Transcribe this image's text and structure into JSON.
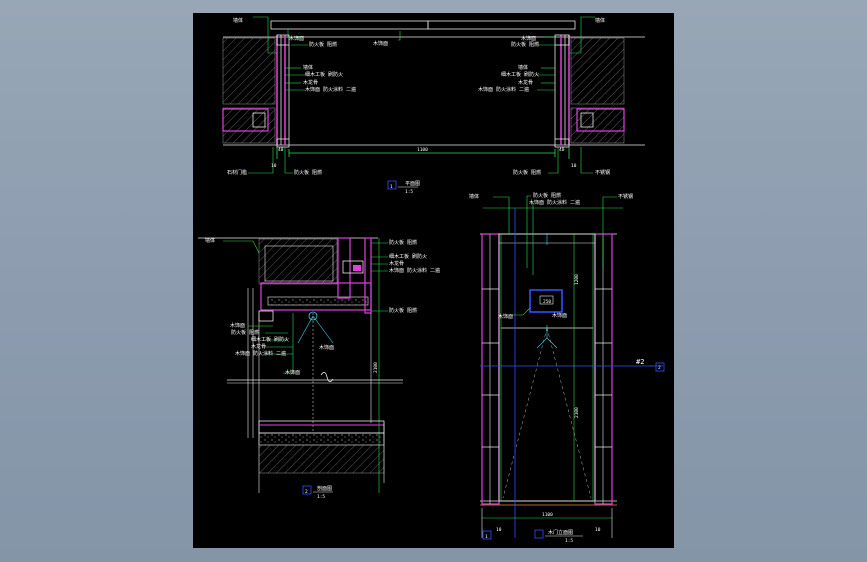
{
  "colors": {
    "background": "#8a9aac",
    "sheet": "#000000",
    "dimension": "#27e04a",
    "frame": "#e040e0",
    "outline": "#e8e8e8",
    "center": "#38d8e8",
    "axis": "#3050ff"
  },
  "top_plan": {
    "labels_left": [
      "墙体",
      "木饰面",
      "防火板 阻燃",
      "墙体",
      "细木工板 刷防火",
      "木龙骨",
      "木饰面 防火涂料 二遍"
    ],
    "labels_right": [
      "墙体",
      "木饰面",
      "防火板 阻燃",
      "墙体",
      "细木工板 刷防火",
      "木龙骨",
      "木饰面 防火涂料 二遍"
    ],
    "center_label": "木饰面",
    "dim_total": "1100",
    "dim_small_left": "40",
    "dim_small_right": "40",
    "dim_ten_left": "10",
    "dim_ten_right": "10",
    "bottom_left": "石材门槛",
    "bottom_mid_left": "防火板 阻燃",
    "bottom_mid_right": "防火板 阻燃",
    "bottom_right": "不锈钢",
    "title_num": "1",
    "title_text": "平面图",
    "title_scale": "1:5"
  },
  "section": {
    "label_wall_top": "墙体",
    "label_right_1": "防火板 阻燃",
    "label_right_2": "细木工板 刷防火",
    "label_right_3": "木龙骨",
    "label_right_4": "木饰面 防火涂料 二遍",
    "label_left_1": "木饰面",
    "label_left_2": "防火板 阻燃",
    "label_left_3": "细木工板 刷防火",
    "label_left_4": "木龙骨",
    "label_left_5": "木饰面 防火涂料 二遍",
    "label_door": "木饰面",
    "label_center": "木饰面",
    "label_bottom_right": "防火板 阻燃",
    "label_left_wall": "墙体",
    "dim_height": "2100",
    "title_num": "2",
    "title_text": "剖面图",
    "title_scale": "1:5"
  },
  "elevation": {
    "label_top_left": "墙体",
    "label_top_1": "防火板 阻燃",
    "label_top_2": "木饰面 防火涂料 二遍",
    "label_top_right": "不锈钢",
    "label_frame": "木饰面",
    "label_center": "木饰面",
    "panel_tag": "250",
    "dim_top": "1200",
    "dim_mid": "2100",
    "dim_bottom": "1100",
    "dim_left": "10",
    "dim_right": "10",
    "axis_marker": "2",
    "axis_tag": "#2",
    "title_num": "1",
    "title_text": "木门立面图",
    "title_scale": "1:5"
  }
}
